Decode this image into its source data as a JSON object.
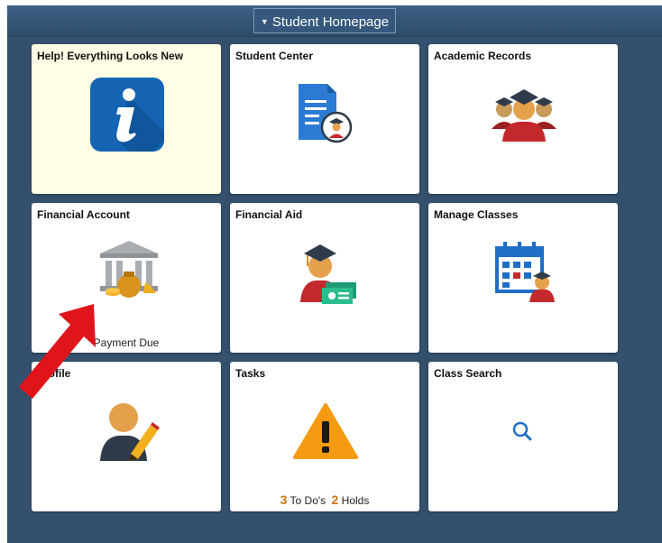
{
  "header": {
    "homepage_label": "Student Homepage"
  },
  "tiles": [
    {
      "title": "Help! Everything Looks New",
      "icon": "info-icon"
    },
    {
      "title": "Student Center",
      "icon": "student-document-icon"
    },
    {
      "title": "Academic Records",
      "icon": "graduates-icon"
    },
    {
      "title": "Financial Account",
      "icon": "bank-money-icon",
      "footer": "Payment Due"
    },
    {
      "title": "Financial Aid",
      "icon": "graduate-money-icon"
    },
    {
      "title": "Manage Classes",
      "icon": "calendar-student-icon"
    },
    {
      "title": "Profile",
      "icon": "user-edit-icon"
    },
    {
      "title": "Tasks",
      "icon": "warning-icon",
      "todos_count": "3",
      "todos_label": "To Do's",
      "holds_count": "2",
      "holds_label": "Holds"
    },
    {
      "title": "Class Search",
      "icon": "search-icon"
    }
  ],
  "colors": {
    "background": "#34506d",
    "help_tile": "#fffde5",
    "accent_orange": "#c9731a",
    "annotation_arrow": "#e0141b"
  }
}
